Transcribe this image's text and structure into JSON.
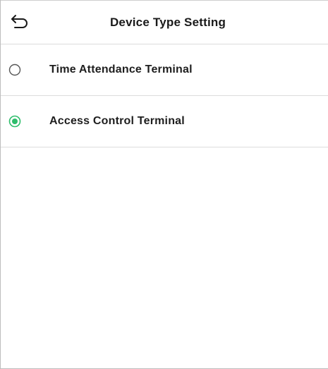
{
  "header": {
    "title": "Device Type Setting",
    "back_icon": "back-arrow-icon"
  },
  "options": [
    {
      "label": "Time Attendance Terminal",
      "selected": false
    },
    {
      "label": "Access Control Terminal",
      "selected": true
    }
  ],
  "colors": {
    "accent": "#2ebd6b",
    "radio_unselected": "#555555",
    "divider": "#dcdcdc"
  }
}
